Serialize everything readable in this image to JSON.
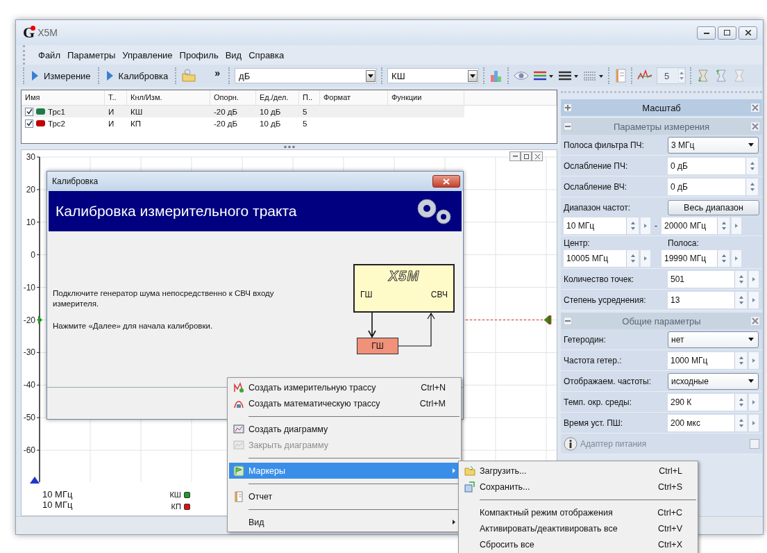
{
  "window": {
    "logo": "G",
    "title": "X5M"
  },
  "menu": [
    "Файл",
    "Параметры",
    "Управление",
    "Профиль",
    "Вид",
    "Справка"
  ],
  "toolbar": {
    "buttons": [
      "Измерение",
      "Калибровка"
    ],
    "overflow": "»",
    "unit_select": "дБ",
    "channel_select": "КШ",
    "count": "5"
  },
  "traces": {
    "columns": [
      "Имя",
      "Т..",
      "Кнл/Изм.",
      "Опорн.",
      "Ед./дел.",
      "П..",
      "Формат",
      "Функции"
    ],
    "rows": [
      {
        "name": "Трс1",
        "checked": true,
        "color": "#1e7a46",
        "type": "И",
        "channel": "КШ",
        "ref": "-20 дБ",
        "scale": "10 дБ",
        "points": "5"
      },
      {
        "name": "Трс2",
        "checked": true,
        "color": "#c00000",
        "type": "И",
        "channel": "КП",
        "ref": "-20 дБ",
        "scale": "10 дБ",
        "points": "5"
      }
    ]
  },
  "chart": {
    "y_labels": [
      "30",
      "20",
      "10",
      "0",
      "-10",
      "-20",
      "-30",
      "-40",
      "-50",
      "-60"
    ],
    "start_labels": [
      "10 МГц",
      "10 МГц"
    ],
    "legend": [
      {
        "label": "КШ",
        "color": "#1e9a2a"
      },
      {
        "label": "КП",
        "color": "#e01010"
      }
    ]
  },
  "dialog": {
    "title": "Калибровка",
    "heading": "Калибровка измерительного тракта",
    "paragraphs": [
      "Подключите генератор шума непосредственно к СВЧ входу измерителя.",
      "Нажмите «Далее» для начала калибровки."
    ],
    "diagram": {
      "device": "X5M",
      "port_left": "ГШ",
      "port_right": "СВЧ",
      "generator": "ГШ"
    }
  },
  "context_menu": [
    {
      "kind": "item",
      "label": "Создать измерительную трассу",
      "shortcut": "Ctrl+N",
      "disabled": false,
      "selected": false,
      "submenu": false
    },
    {
      "kind": "item",
      "label": "Создать математическую трассу",
      "shortcut": "Ctrl+M",
      "disabled": false,
      "selected": false,
      "submenu": false
    },
    {
      "kind": "separator"
    },
    {
      "kind": "item",
      "label": "Создать диаграмму",
      "disabled": false,
      "selected": false,
      "submenu": false
    },
    {
      "kind": "item",
      "label": "Закрыть диаграмму",
      "disabled": true,
      "selected": false,
      "submenu": false
    },
    {
      "kind": "separator"
    },
    {
      "kind": "item",
      "label": "Маркеры",
      "disabled": false,
      "selected": true,
      "submenu": true
    },
    {
      "kind": "separator"
    },
    {
      "kind": "item",
      "label": "Отчет",
      "disabled": false,
      "selected": false,
      "submenu": false
    },
    {
      "kind": "separator"
    },
    {
      "kind": "item",
      "label": "Вид",
      "disabled": false,
      "selected": false,
      "submenu": true
    }
  ],
  "submenu": [
    {
      "kind": "item",
      "label": "Загрузить...",
      "shortcut": "Ctrl+L"
    },
    {
      "kind": "item",
      "label": "Сохранить...",
      "shortcut": "Ctrl+S"
    },
    {
      "kind": "separator"
    },
    {
      "kind": "item",
      "label": "Компактный режим отображения",
      "shortcut": "Ctrl+C"
    },
    {
      "kind": "item",
      "label": "Активировать/деактивировать все",
      "shortcut": "Ctrl+V"
    },
    {
      "kind": "item",
      "label": "Сбросить все",
      "shortcut": "Ctrl+X"
    }
  ],
  "panel": {
    "sections": [
      {
        "title": "Масштаб",
        "expanded": false
      },
      {
        "title": "Параметры измерения",
        "expanded": true,
        "rows": [
          {
            "kind": "select",
            "label": "Полоса фильтра ПЧ:",
            "value": "3 МГц"
          },
          {
            "kind": "spin_short",
            "label": "Ослабление ПЧ:",
            "value": "0 дБ"
          },
          {
            "kind": "spin_short",
            "label": "Ослабление ВЧ:",
            "value": "0 дБ"
          },
          {
            "kind": "range",
            "label": "Диапазон частот:",
            "button": "Весь диапазон",
            "from": "10 МГц",
            "separator": "-",
            "to": "20000 МГц"
          },
          {
            "kind": "pair",
            "left_label": "Центр:",
            "left_value": "10005 МГц",
            "right_label": "Полоса:",
            "right_value": "19990 МГц"
          },
          {
            "kind": "spin",
            "label": "Количество точек:",
            "value": "501"
          },
          {
            "kind": "spin",
            "label": "Степень усреднения:",
            "value": "13"
          }
        ]
      },
      {
        "title": "Общие параметры",
        "expanded": true,
        "rows": [
          {
            "kind": "select",
            "label": "Гетеродин:",
            "value": "нет"
          },
          {
            "kind": "spin",
            "label": "Частота гетер.:",
            "value": "1000 МГц"
          },
          {
            "kind": "select",
            "label": "Отображаем. частоты:",
            "value": "исходные"
          },
          {
            "kind": "spin",
            "label": "Темп. окр. среды:",
            "value": "290 К"
          },
          {
            "kind": "spin",
            "label": "Время уст. ПШ:",
            "value": "200 мкс"
          },
          {
            "kind": "checkbox",
            "label": "Адаптер питания",
            "checked": false,
            "disabled": true
          }
        ]
      }
    ]
  }
}
